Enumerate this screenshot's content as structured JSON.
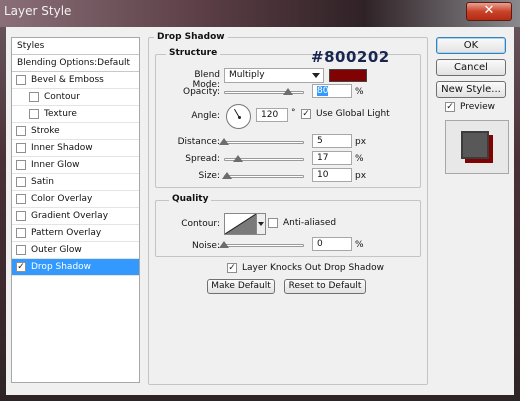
{
  "window": {
    "title": "Layer Style",
    "close_glyph": "✕"
  },
  "styles_panel": {
    "header": "Styles",
    "blending": "Blending Options:Default",
    "items": [
      {
        "label": "Bevel & Emboss",
        "checked": false,
        "sub": false,
        "selected": false
      },
      {
        "label": "Contour",
        "checked": false,
        "sub": true,
        "selected": false
      },
      {
        "label": "Texture",
        "checked": false,
        "sub": true,
        "selected": false
      },
      {
        "label": "Stroke",
        "checked": false,
        "sub": false,
        "selected": false
      },
      {
        "label": "Inner Shadow",
        "checked": false,
        "sub": false,
        "selected": false
      },
      {
        "label": "Inner Glow",
        "checked": false,
        "sub": false,
        "selected": false
      },
      {
        "label": "Satin",
        "checked": false,
        "sub": false,
        "selected": false
      },
      {
        "label": "Color Overlay",
        "checked": false,
        "sub": false,
        "selected": false
      },
      {
        "label": "Gradient Overlay",
        "checked": false,
        "sub": false,
        "selected": false
      },
      {
        "label": "Pattern Overlay",
        "checked": false,
        "sub": false,
        "selected": false
      },
      {
        "label": "Outer Glow",
        "checked": false,
        "sub": false,
        "selected": false
      },
      {
        "label": "Drop Shadow",
        "checked": true,
        "sub": false,
        "selected": true
      }
    ]
  },
  "drop_shadow": {
    "title": "Drop Shadow",
    "structure": {
      "title": "Structure",
      "blend_mode_label": "Blend Mode:",
      "blend_mode_value": "Multiply",
      "shadow_color": "#800202",
      "opacity_label": "Opacity:",
      "opacity_value": "80",
      "opacity_unit": "%",
      "opacity_level": 0.8,
      "angle_label": "Angle:",
      "angle_value": "120",
      "angle_unit": "°",
      "global_light_label": "Use Global Light",
      "global_light_checked": true,
      "distance_label": "Distance:",
      "distance_value": "5",
      "distance_unit": "px",
      "distance_level": 0.0,
      "spread_label": "Spread:",
      "spread_value": "17",
      "spread_unit": "%",
      "spread_level": 0.17,
      "size_label": "Size:",
      "size_value": "10",
      "size_unit": "px",
      "size_level": 0.04
    },
    "quality": {
      "title": "Quality",
      "contour_label": "Contour:",
      "anti_aliased_label": "Anti-aliased",
      "anti_aliased_checked": false,
      "noise_label": "Noise:",
      "noise_value": "0",
      "noise_unit": "%",
      "noise_level": 0.0
    },
    "knocks_out_label": "Layer Knocks Out Drop Shadow",
    "knocks_out_checked": true,
    "make_default_label": "Make Default",
    "reset_default_label": "Reset to Default"
  },
  "annotation_hex": "#800202",
  "buttons": {
    "ok": "OK",
    "cancel": "Cancel",
    "new_style": "New Style...",
    "preview_label": "Preview",
    "preview_checked": true
  },
  "colors": {
    "accent_selected": "#3399ff",
    "shadow": "#800202"
  },
  "icons": {
    "check": "✓"
  }
}
